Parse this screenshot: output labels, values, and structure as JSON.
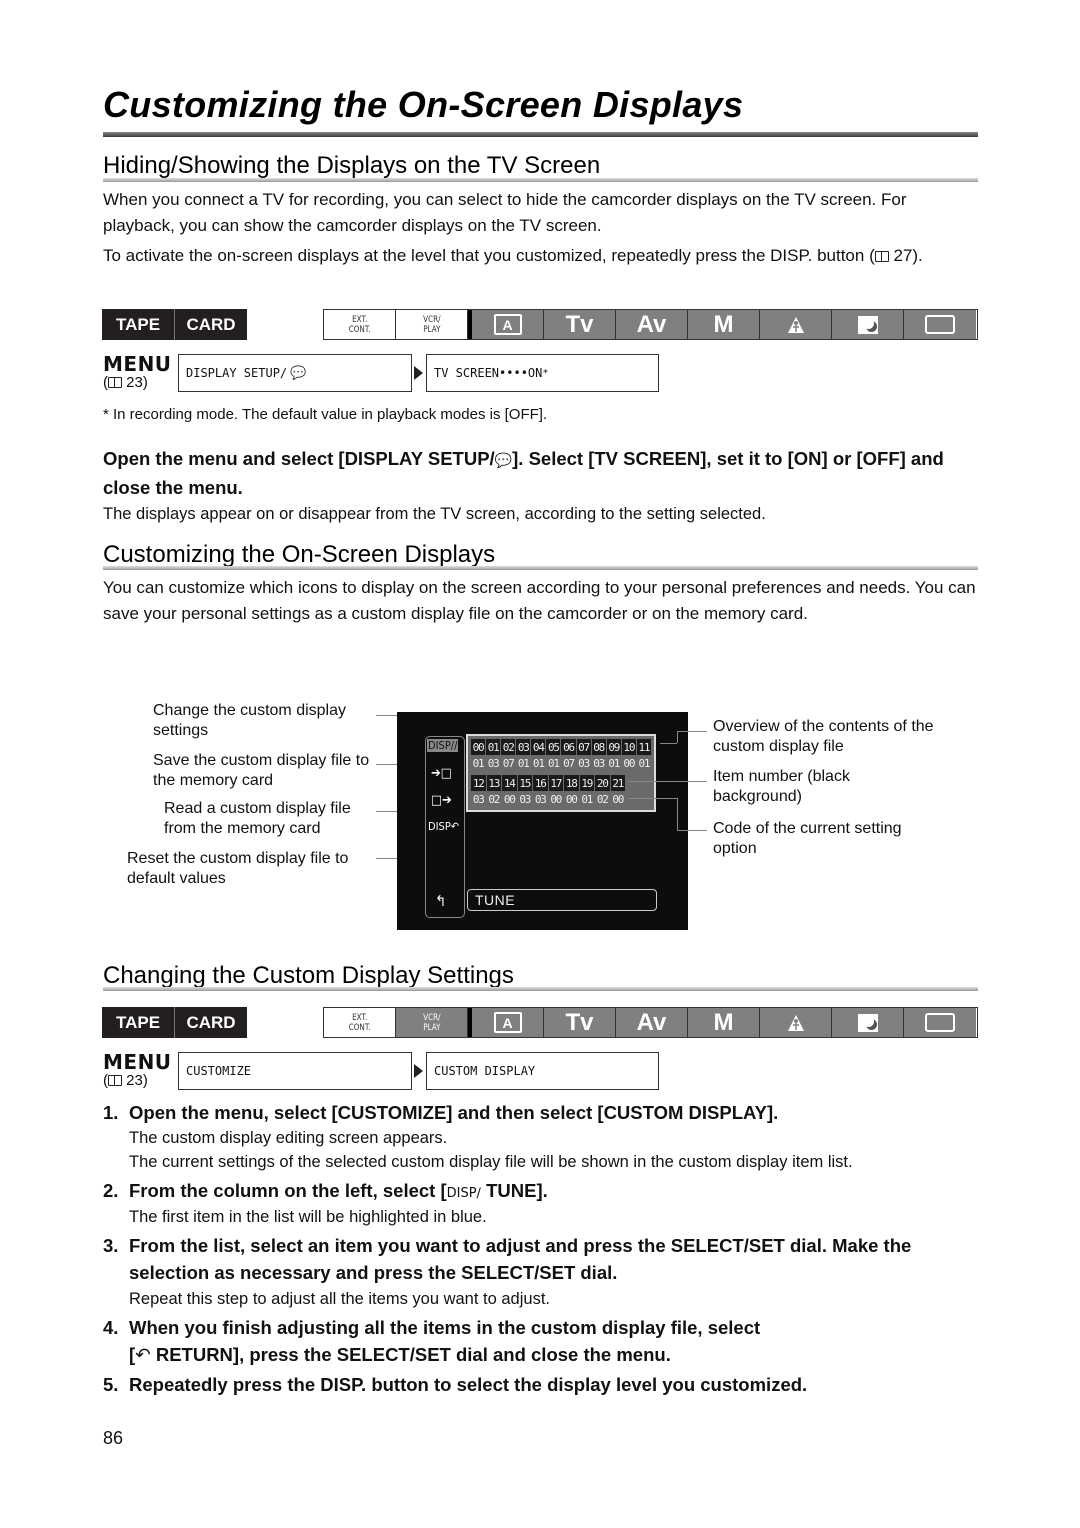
{
  "page": {
    "title": "Customizing the On-Screen Displays",
    "page_number": "86"
  },
  "section1": {
    "heading": "Hiding/Showing the Displays on the TV Screen",
    "para1": "When you connect a TV for recording, you can select to hide the camcorder displays on the TV screen. For playback, you can show the camcorder displays on the TV screen.",
    "para2": "To activate the on-screen displays at the level that you customized, repeatedly press the DISP. button",
    "para2_ref": "27).",
    "mode_bar": {
      "media": [
        "TAPE",
        "CARD"
      ],
      "ext_cont": [
        "EXT.",
        "CONT."
      ],
      "vcr_play": [
        "VCR/",
        "PLAY"
      ],
      "modes": [
        "A",
        "Tv",
        "Av",
        "M",
        "spotlight-icon",
        "night-icon",
        "frame-icon"
      ],
      "active_highlight": "recording"
    },
    "menu": {
      "label": "MENU",
      "ref": "23)",
      "path_from": "DISPLAY SETUP/",
      "path_to": "TV SCREEN••••ON",
      "asterisk": "*"
    },
    "footnote": "*  In recording mode. The default value in playback modes is [OFF].",
    "instruction_a": "Open the menu and select [DISPLAY SETUP/",
    "instruction_b": "]. Select [TV SCREEN], set it to [ON] or [OFF] and close the menu.",
    "instruction_note": "The displays appear on or disappear from the TV screen, according to the setting selected."
  },
  "section2": {
    "heading": "Customizing the On-Screen Displays",
    "para": "You can customize which icons to display on the screen according to your personal preferences and needs. You can save your personal settings as a custom display file on the camcorder or on the memory card.",
    "callouts_left": [
      "Change the custom display settings",
      "Save the custom display file to the memory card",
      "Read a custom display file from the memory card",
      "Reset the custom display file to default values"
    ],
    "callouts_right": [
      "Overview of the contents of the custom display file",
      "Item number (black background)",
      "Code of the current setting option"
    ],
    "screen": {
      "left_icons": [
        "DISP∕∕",
        "➔□",
        "□➔",
        "DISP↶",
        "↰"
      ],
      "item_numbers_row1": [
        "00",
        "01",
        "02",
        "03",
        "04",
        "05",
        "06",
        "07",
        "08",
        "09",
        "10",
        "11"
      ],
      "codes_row1": [
        "01",
        "03",
        "07",
        "01",
        "01",
        "01",
        "07",
        "03",
        "03",
        "01",
        "00",
        "01"
      ],
      "item_numbers_row2": [
        "12",
        "13",
        "14",
        "15",
        "16",
        "17",
        "18",
        "19",
        "20",
        "21"
      ],
      "codes_row2": [
        "03",
        "02",
        "00",
        "03",
        "03",
        "00",
        "00",
        "01",
        "02",
        "00"
      ],
      "tune_label": "TUNE"
    }
  },
  "section3": {
    "heading": "Changing the Custom Display Settings",
    "mode_bar": {
      "media": [
        "TAPE",
        "CARD"
      ],
      "ext_cont": [
        "EXT.",
        "CONT."
      ],
      "vcr_play": [
        "VCR/",
        "PLAY"
      ],
      "modes": [
        "A",
        "Tv",
        "Av",
        "M",
        "spotlight-icon",
        "night-icon",
        "frame-icon"
      ],
      "active_highlight": "vcr-play-and-recording"
    },
    "menu": {
      "label": "MENU",
      "ref": "23)",
      "path_from": "CUSTOMIZE",
      "path_to": "CUSTOM DISPLAY"
    },
    "steps": [
      {
        "num": "1.",
        "text": "Open the menu, select [CUSTOMIZE] and then select [CUSTOM DISPLAY].",
        "notes": [
          "The custom display editing screen appears.",
          "The current settings of the selected custom display file will be shown in the custom display item list."
        ]
      },
      {
        "num": "2.",
        "text_a": "From the column on the left, select [",
        "icon": "DISP∕",
        "text_b": " TUNE].",
        "notes": [
          "The first item in the list will be highlighted in blue."
        ]
      },
      {
        "num": "3.",
        "text": "From the list, select an item you want to adjust and press the SELECT/SET dial. Make the selection as necessary and press the SELECT/SET dial.",
        "notes": [
          "Repeat this step to adjust all the items you want to adjust."
        ]
      },
      {
        "num": "4.",
        "text_a": "When you finish adjusting all the items in the custom display file, select",
        "text_b": "[",
        "icon": "↶",
        "text_c": " RETURN], press the SELECT/SET dial and close the menu."
      },
      {
        "num": "5.",
        "text": "Repeatedly press the DISP. button to select the display level you customized."
      }
    ]
  }
}
